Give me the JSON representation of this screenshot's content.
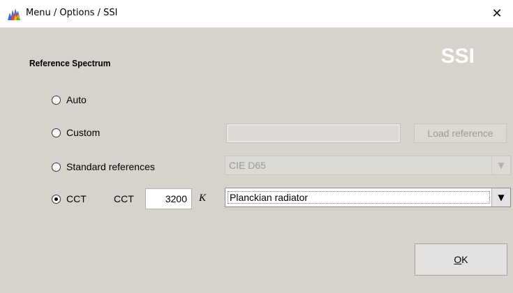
{
  "window": {
    "title": "Menu / Options / SSI",
    "close_glyph": "✕",
    "icon": "app-spectrum-icon"
  },
  "brand": {
    "text": "SSI"
  },
  "section": {
    "title": "Reference Spectrum"
  },
  "options": {
    "auto": {
      "label": "Auto",
      "checked": false
    },
    "custom": {
      "label": "Custom",
      "checked": false,
      "path_value": "",
      "load_button": "Load reference",
      "load_enabled": false
    },
    "standard": {
      "label": "Standard references",
      "checked": false,
      "selected": "CIE D65",
      "enabled": false
    },
    "cct": {
      "label": "CCT",
      "checked": true,
      "field_label": "CCT",
      "value": "3200",
      "unit": "K",
      "radiator": "Planckian radiator",
      "enabled": true
    }
  },
  "buttons": {
    "ok_mnemonic": "O",
    "ok_rest": "K"
  },
  "colors": {
    "background": "#d6d2cc",
    "brand": "#ffffff",
    "disabled_text": "#9b9b9b"
  }
}
